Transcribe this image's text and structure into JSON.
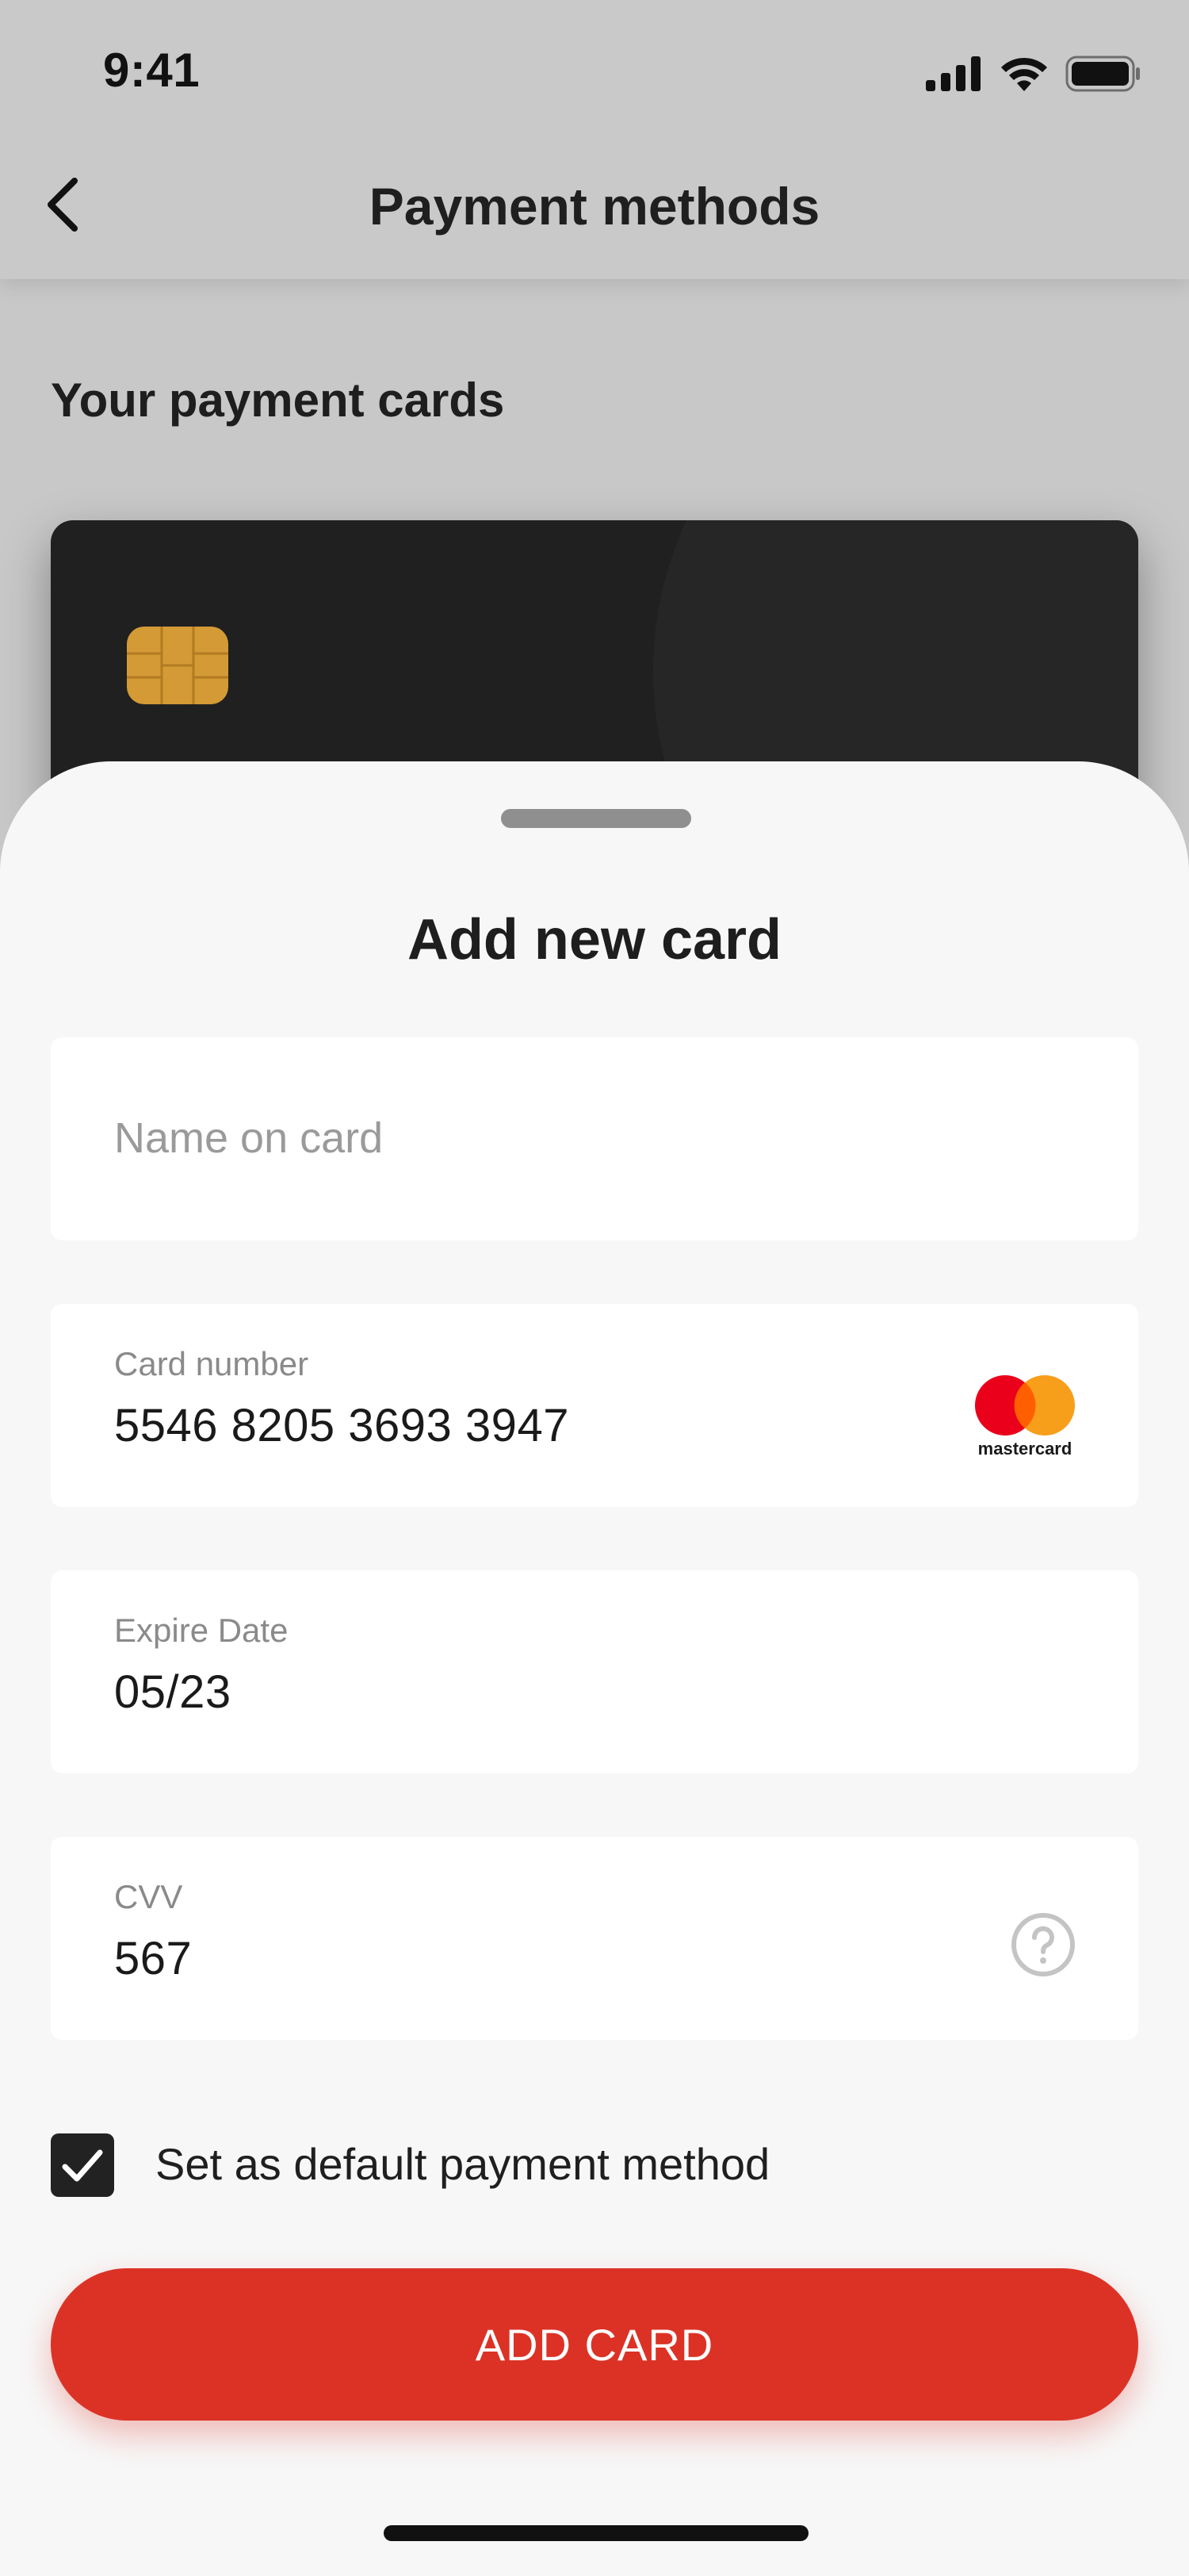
{
  "status_bar": {
    "time": "9:41"
  },
  "header": {
    "title": "Payment methods",
    "back_icon": "chevron-left-icon"
  },
  "section": {
    "title": "Your payment cards"
  },
  "sheet": {
    "title": "Add new card",
    "name_field": {
      "placeholder": "Name on card"
    },
    "card_number_field": {
      "label": "Card number",
      "value": "5546 8205 3693 3947",
      "brand_text": "mastercard",
      "brand_icon": "mastercard-logo-icon"
    },
    "expire_field": {
      "label": "Expire Date",
      "value": "05/23"
    },
    "cvv_field": {
      "label": "CVV",
      "value": "567",
      "help_icon": "question-circle-icon"
    },
    "default_checkbox": {
      "label": "Set as default payment method",
      "checked": true
    },
    "submit_label": "ADD CARD"
  },
  "colors": {
    "accent": "#dc3226",
    "card": "#202020",
    "chip": "#d49a36",
    "mastercard_red": "#eb001b",
    "mastercard_orange": "#f79e1b",
    "overlay": "#c8c8c8",
    "sheet": "#f7f7f7"
  }
}
